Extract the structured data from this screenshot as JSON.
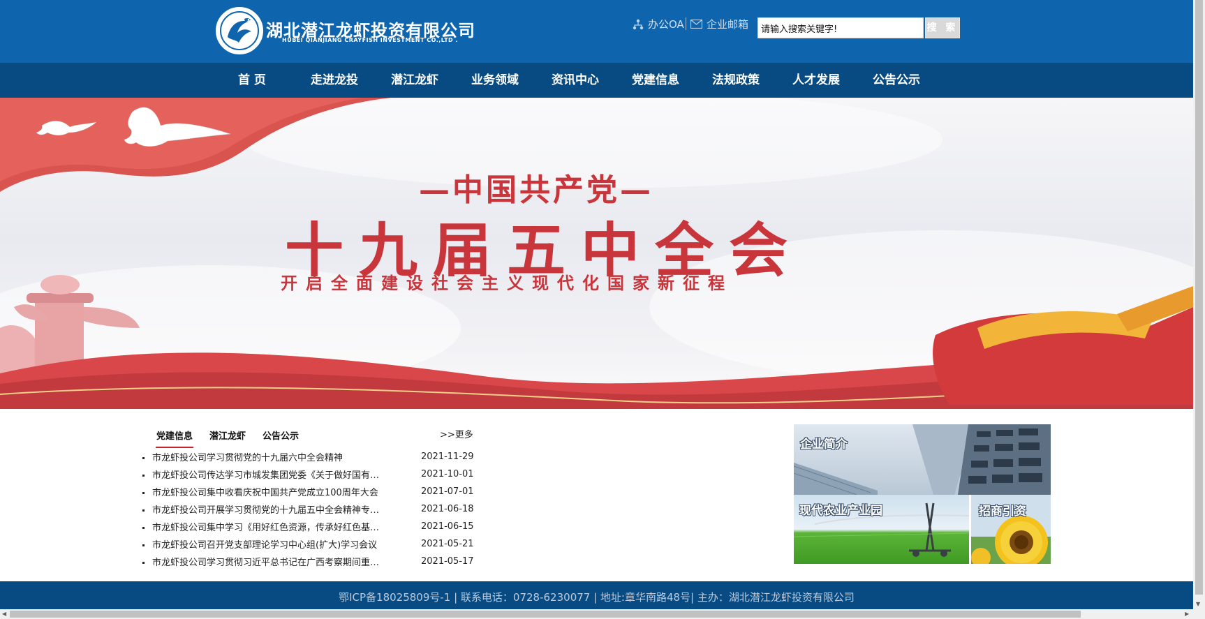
{
  "header": {
    "company_name": "湖北潜江龙虾投资有限公司",
    "company_name_en": "HUBEI QIANJIANG CRAYFISH INVESTMENT CO.,LTD .",
    "links": [
      {
        "label": "办公OA",
        "icon": "network-icon"
      },
      {
        "label": "企业邮箱",
        "icon": "envelope-icon"
      }
    ],
    "search": {
      "value": "请输入搜索关键字!",
      "button_label": "搜 索"
    }
  },
  "nav": {
    "items": [
      "首 页",
      "走进龙投",
      "潜江龙虾",
      "业务领域",
      "资讯中心",
      "党建信息",
      "法规政策",
      "人才发展",
      "公告公示"
    ]
  },
  "banner": {
    "line1": "—中国共产党—",
    "line2": "十九届五中全会",
    "line3": "开启全面建设社会主义现代化国家新征程"
  },
  "news": {
    "tabs": [
      "党建信息",
      "潜江龙虾",
      "公告公示"
    ],
    "active_tab": "党建信息",
    "more_label": ">>更多",
    "items": [
      {
        "title": "市龙虾投公司学习贯彻党的十九届六中全会精神",
        "date": "2021-11-29"
      },
      {
        "title": "市龙虾投公司传达学习市城发集团党委《关于做好国有企业党建工作的通知》",
        "date": "2021-10-01"
      },
      {
        "title": "市龙虾投公司集中收看庆祝中国共产党成立100周年大会",
        "date": "2021-07-01"
      },
      {
        "title": "市龙虾投公司开展学习贯彻党的十九届五中全会精神专题学习",
        "date": "2021-06-18"
      },
      {
        "title": "市龙虾投公司集中学习《用好红色资源，传承好红色基因》",
        "date": "2021-06-15"
      },
      {
        "title": "市龙虾投公司召开党支部理论学习中心组(扩大)学习会议",
        "date": "2021-05-21"
      },
      {
        "title": "市龙虾投公司学习贯彻习近平总书记在广西考察期间重要讲话精神",
        "date": "2021-05-17"
      }
    ]
  },
  "panels": {
    "intro": "企业简介",
    "agri": "现代农业产业园",
    "invest": "招商引资"
  },
  "footer": {
    "text": "鄂ICP备18025809号-1 | 联系电话：0728-6230077 | 地址:章华南路48号| 主办：湖北潜江龙虾投资有限公司"
  },
  "colors": {
    "header_bg": "#0e64ad",
    "nav_bg": "#074b82",
    "accent_red": "#c8353b",
    "tab_underline": "#c8202a"
  }
}
